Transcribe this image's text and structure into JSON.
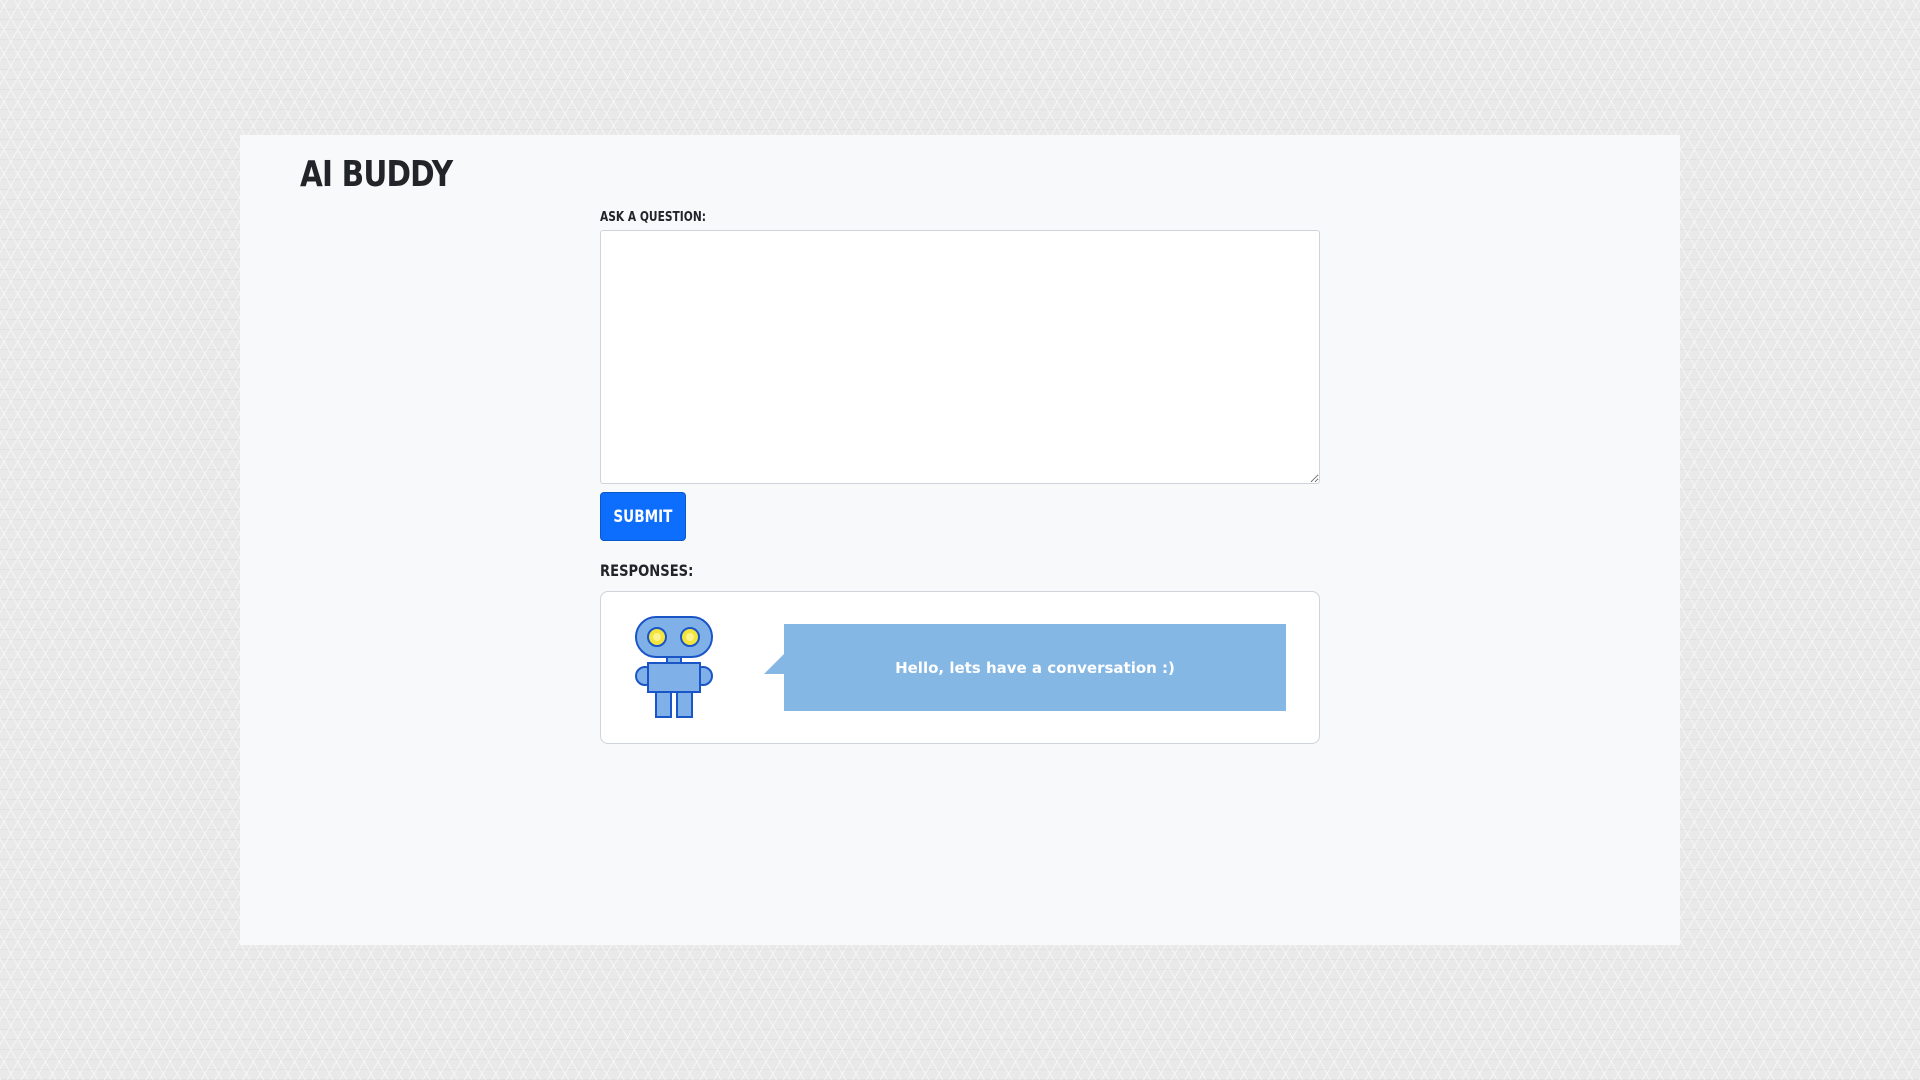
{
  "app": {
    "title": "AI BUDDY"
  },
  "question": {
    "label": "Ask a question:",
    "value": "",
    "placeholder": ""
  },
  "submit": {
    "label": "SUBMIT"
  },
  "responses": {
    "label": "Responses:",
    "items": [
      {
        "avatar_icon": "robot-icon",
        "text": "Hello, lets have a conversation :)"
      }
    ]
  },
  "colors": {
    "primary_button": "#0d6efd",
    "bubble": "#85b7e5",
    "robot_body": "#7fb1e8",
    "robot_outline": "#1a55c8",
    "robot_eye": "#f4e53c",
    "panel_background": "#f8f9fa"
  }
}
